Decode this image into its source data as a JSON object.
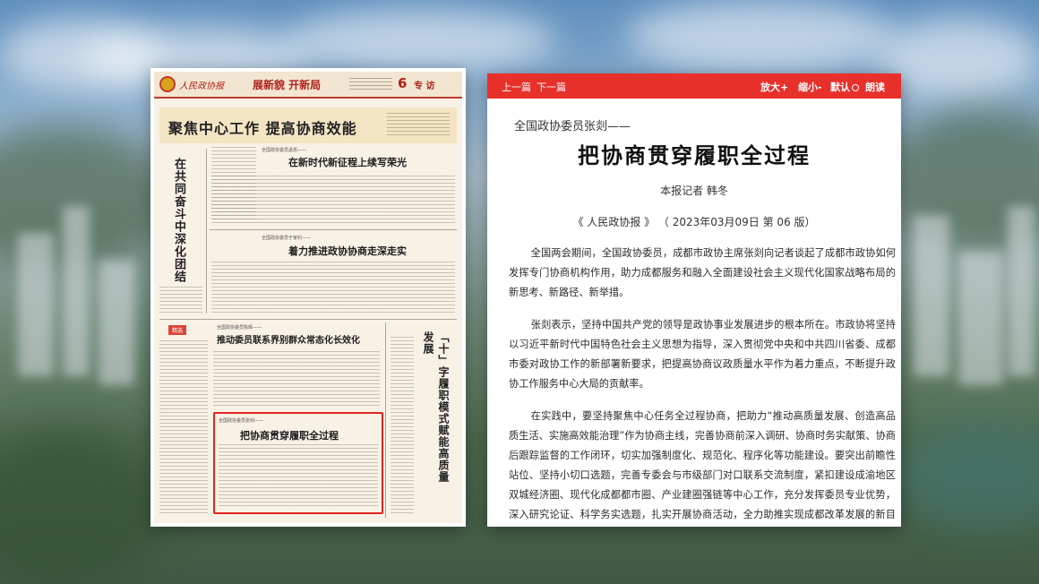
{
  "newspaper": {
    "brand": "人民政协报",
    "column_title": "展新貌 开新局",
    "page_number": "6",
    "section": "专 访",
    "lead_headline": "聚焦中心工作 提高协商效能",
    "vertical_headline_1": "在共同奋斗中深化团结",
    "vertical_headline_2": "「十」字履职模式赋能高质量发展",
    "kicker_1": "全国政协委员孟凯——",
    "headline_1": "在新时代新征程上续写荣光",
    "kicker_2": "全国政协委员于家利——",
    "headline_2": "着力推进政协协商走深走实",
    "kicker_3": "全国政协委员陈辉——",
    "headline_3": "推动委员联系界别群众常态化长效化",
    "kicker_4": "全国政协委员张剡——",
    "headline_4": "把协商贯穿履职全过程",
    "tag": "精选"
  },
  "reader": {
    "toolbar": {
      "prev": "上一篇",
      "next": "下一篇",
      "zoom_in": "放大+",
      "zoom_out": "缩小-",
      "reset": "默认",
      "read_aloud": "朗读"
    },
    "article": {
      "kicker": "全国政协委员张剡——",
      "title": "把协商贯穿履职全过程",
      "byline": "本报记者 韩冬",
      "source": "《 人民政协报 》 （ 2023年03月09日   第 06 版）",
      "paragraphs": [
        "全国两会期间，全国政协委员，成都市政协主席张剡向记者谈起了成都市政协如何发挥专门协商机构作用，助力成都服务和融入全面建设社会主义现代化国家战略布局的新思考、新路径、新举措。",
        "张剡表示，坚持中国共产党的领导是政协事业发展进步的根本所在。市政协将坚持以习近平新时代中国特色社会主义思想为指导，深入贯彻党中央和中共四川省委、成都市委对政协工作的新部署新要求，把提高协商议政质量水平作为着力重点，不断提升政协工作服务中心大局的贡献率。",
        "在实践中，要坚持聚焦中心任务全过程协商，把助力“推动高质量发展、创造高品质生活、实施高效能治理”作为协商主线，完善协商前深入调研、协商时务实献策、协商后跟踪监督的工作闭环，切实加强制度化、规范化、程序化等功能建设。要突出前瞻性站位、坚持小切口选题，完善专委会与市级部门对口联系交流制度，紧扣建设成渝地区双城经济圈、现代化成都都市圈、产业建圈强链等中心工作，充分发挥委员专业优势，深入研究论证、科学务实选题，扎实开展协商活动，全力助推实现成都改革发展的新目标新愿"
      ]
    }
  }
}
